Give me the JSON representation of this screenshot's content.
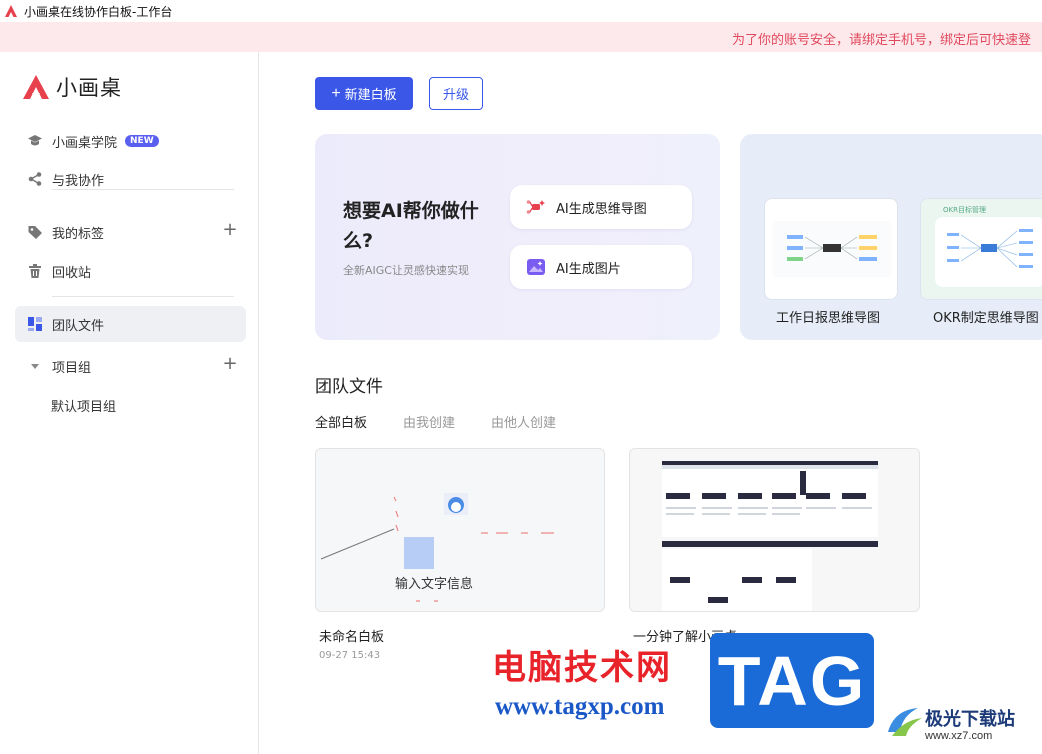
{
  "window": {
    "title": "小画桌在线协作白板-工作台"
  },
  "notice": {
    "text": "为了你的账号安全，请绑定手机号，绑定后可快速登"
  },
  "brand": {
    "name": "小画桌",
    "color": "#e8414e"
  },
  "sidebar": {
    "items": [
      {
        "label": "小画桌学院",
        "icon": "graduation-cap-icon",
        "badge": "NEW"
      },
      {
        "label": "与我协作",
        "icon": "share-icon"
      },
      {
        "label": "我的标签",
        "icon": "tag-icon"
      },
      {
        "label": "回收站",
        "icon": "trash-icon"
      },
      {
        "label": "团队文件",
        "icon": "grid-icon",
        "active": true
      },
      {
        "label": "项目组",
        "icon": "caret-down-icon"
      }
    ],
    "sub_items": [
      "默认项目组"
    ]
  },
  "toolbar": {
    "new_label": "新建白板",
    "upgrade_label": "升级"
  },
  "ai_card": {
    "title": "想要AI帮你做什么?",
    "subtitle": "全新AIGC让灵感快速实现",
    "buttons": [
      {
        "label": "AI生成思维导图",
        "icon": "mindmap-icon"
      },
      {
        "label": "AI生成图片",
        "icon": "image-sparkle-icon"
      }
    ]
  },
  "templates": [
    {
      "label": "工作日报思维导图"
    },
    {
      "label": "OKR制定思维导图",
      "thumb_title": "OKR目标管理"
    }
  ],
  "section": {
    "title": "团队文件",
    "tabs": [
      "全部白板",
      "由我创建",
      "由他人创建"
    ]
  },
  "files": [
    {
      "name": "未命名白板",
      "date": "09-27 15:43",
      "preview_text": "输入文字信息"
    },
    {
      "name": "一分钟了解小画桌",
      "date": ""
    }
  ],
  "watermark": {
    "site_name": "电脑技术网",
    "url": "www.tagxp.com",
    "tag": "TAG",
    "jg_name": "极光下载站",
    "jg_url": "www.xz7.com"
  },
  "colors": {
    "primary": "#3a57e8",
    "notice_bg": "#fde9ec",
    "notice_text": "#e0495d"
  }
}
